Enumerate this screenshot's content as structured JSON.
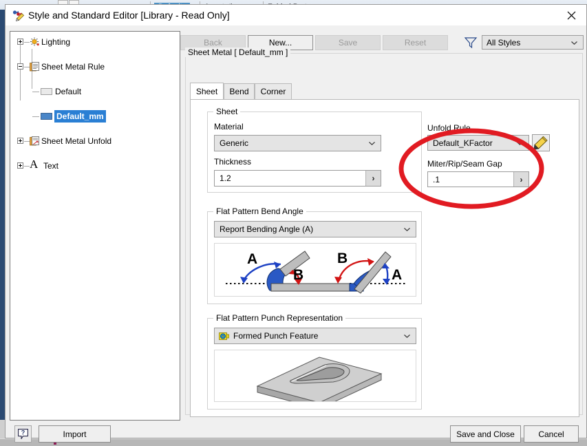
{
  "background": {
    "ribbon_tabs": [
      "Defaults",
      "Annotation",
      "Folded Part"
    ],
    "selected_ribbon_tab": "Defaults"
  },
  "window": {
    "title": "Style and Standard Editor [Library - Read Only]",
    "icon": "style-editor-icon",
    "close_label": "×"
  },
  "tree": {
    "nodes": [
      {
        "label": "Lighting",
        "icon": "lighting-icon",
        "indent": 0,
        "expander": "plus",
        "selected": false
      },
      {
        "label": "Sheet Metal Rule",
        "icon": "sheet-metal-rule-icon",
        "indent": 0,
        "expander": "minus",
        "selected": false
      },
      {
        "label": "Default",
        "icon": "style-gray-icon",
        "indent": 1,
        "expander": "none",
        "selected": false
      },
      {
        "label": "Default_mm",
        "icon": "style-blue-icon",
        "indent": 1,
        "expander": "none",
        "selected": true
      },
      {
        "label": "Sheet Metal Unfold",
        "icon": "sheet-metal-unfold-icon",
        "indent": 0,
        "expander": "plus",
        "selected": false
      },
      {
        "label": "Text",
        "icon": "text-A-icon",
        "indent": 0,
        "expander": "plus",
        "selected": false
      }
    ]
  },
  "toolbar": {
    "back_label": "Back",
    "back_enabled": false,
    "new_label": "New...",
    "new_enabled": true,
    "save_label": "Save",
    "save_enabled": false,
    "reset_label": "Reset",
    "reset_enabled": false,
    "filter_icon": "funnel-icon",
    "style_filter_value": "All Styles",
    "style_filter_options": [
      "All Styles"
    ]
  },
  "group": {
    "header": "Sheet Metal [ Default_mm ]"
  },
  "tabs": [
    {
      "label": "Sheet",
      "active": true
    },
    {
      "label": "Bend",
      "active": false
    },
    {
      "label": "Corner",
      "active": false
    }
  ],
  "sheet_group": {
    "title": "Sheet",
    "material_label": "Material",
    "material_value": "Generic",
    "material_options": [
      "Generic"
    ],
    "thickness_label": "Thickness",
    "thickness_value": "1.2",
    "thickness_more": "›"
  },
  "unfold": {
    "rule_label": "Unfold Rule",
    "rule_value": "Default_KFactor",
    "rule_options": [
      "Default_KFactor"
    ],
    "edit_icon": "pencil-edit-icon",
    "gap_label": "Miter/Rip/Seam Gap",
    "gap_value": ".1",
    "gap_more": "›"
  },
  "bend_angle": {
    "title": "Flat Pattern Bend Angle",
    "value": "Report Bending Angle (A)",
    "options": [
      "Report Bending Angle (A)"
    ],
    "illustration": "bend-angle-diagram",
    "annotations": [
      "A",
      "B",
      "B",
      "A"
    ]
  },
  "punch": {
    "title": "Flat Pattern Punch Representation",
    "value": "Formed Punch Feature",
    "value_icon": "formed-punch-icon",
    "options": [
      "Formed Punch Feature"
    ],
    "illustration": "formed-punch-preview"
  },
  "footer": {
    "help_label": "?",
    "import_label": "Import",
    "save_and_close_label": "Save and Close",
    "cancel_label": "Cancel"
  },
  "annotation": {
    "shape": "red-ellipse-highlight",
    "color": "#e11b22",
    "targets": [
      "Miter/Rip/Seam Gap"
    ]
  },
  "colors": {
    "selection_blue": "#2a7fd4",
    "annotation_red": "#e11b22",
    "dialog_bg": "#f0f0f0",
    "panel_white": "#ffffff"
  }
}
